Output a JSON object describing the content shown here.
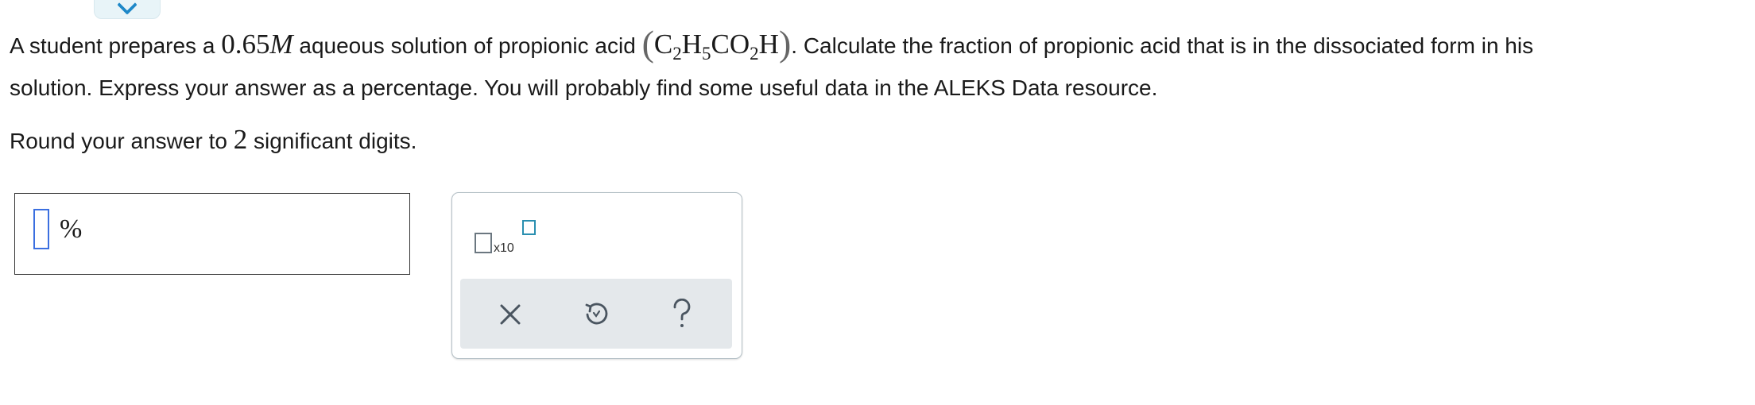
{
  "question": {
    "part1": "A student prepares a ",
    "concentration": "0.65",
    "unit_M": "M",
    "part2": " aqueous solution of propionic acid ",
    "formula": {
      "open": "(",
      "c1": "C",
      "c1_sub": "2",
      "h1": "H",
      "h1_sub": "5",
      "co": "CO",
      "co_sub": "2",
      "h2": "H",
      "close": ")"
    },
    "part3": ". Calculate the fraction of propionic acid that is in the dissociated form in his",
    "line2": "solution. Express your answer as a percentage. You will probably find some useful data in the ALEKS Data resource."
  },
  "rounding": {
    "prefix": "Round your answer to ",
    "digits": "2",
    "suffix": " significant digits."
  },
  "answer": {
    "value": "",
    "unit": "%"
  },
  "tools": {
    "sci_label": "x10"
  }
}
